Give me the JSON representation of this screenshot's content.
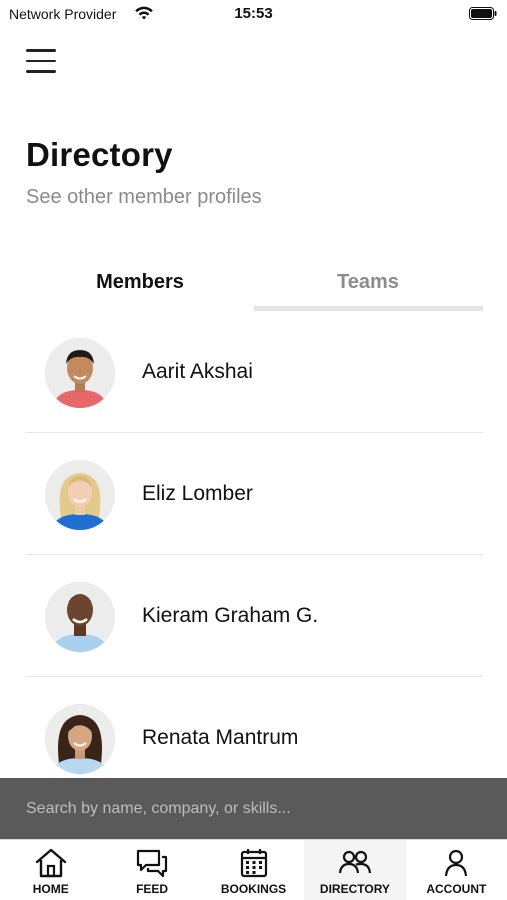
{
  "status_bar": {
    "carrier": "Network Provider",
    "time": "15:53"
  },
  "header": {
    "title": "Directory",
    "subtitle": "See other member profiles"
  },
  "tabs": [
    {
      "label": "Members",
      "active": true
    },
    {
      "label": "Teams",
      "active": false
    }
  ],
  "members": [
    {
      "name": "Aarit Akshai",
      "avatar": "man-red-shirt"
    },
    {
      "name": "Eliz Lomber",
      "avatar": "woman-blonde-blue-top"
    },
    {
      "name": "Kieram Graham G.",
      "avatar": "man-light-blue-shirt"
    },
    {
      "name": "Renata Mantrum",
      "avatar": "woman-dark-hair-light-blue"
    }
  ],
  "search": {
    "placeholder": "Search by name, company, or skills..."
  },
  "tab_bar": [
    {
      "label": "HOME",
      "icon": "home-icon"
    },
    {
      "label": "FEED",
      "icon": "chat-icon"
    },
    {
      "label": "BOOKINGS",
      "icon": "calendar-icon"
    },
    {
      "label": "DIRECTORY",
      "icon": "people-icon",
      "active": true
    },
    {
      "label": "ACCOUNT",
      "icon": "person-icon"
    }
  ]
}
